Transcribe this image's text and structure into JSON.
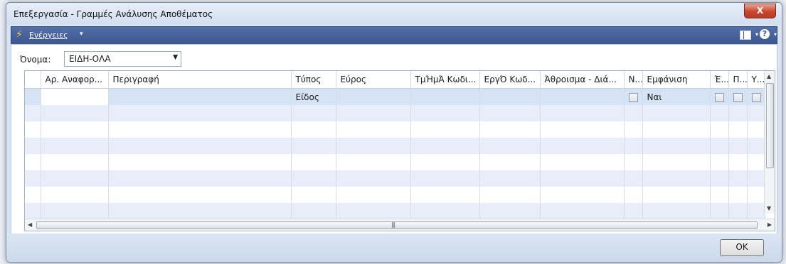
{
  "window": {
    "title": "Επεξεργασία - Γραμμές Ανάλυσης Αποθέματος",
    "close": "X"
  },
  "actionbar": {
    "actions_label": "Ενέργειες",
    "caret": "▾"
  },
  "filter": {
    "label": "Όνομα:",
    "value": "ΕΙΔΗ-ΟΛΑ"
  },
  "table": {
    "columns": [
      "Αρ. Αναφορ...",
      "Περιγραφή",
      "Τύπος",
      "Εύρος",
      "ΤμΉμΆ Κωδι...",
      "ΕργΌ Κωδ...",
      "Άθροισμα - Διά...",
      "Ν...",
      "Εμφάνιση",
      "Έ...",
      "Π...",
      "Υ..."
    ],
    "row1": {
      "type": "Είδος",
      "display": "Ναι"
    }
  },
  "footer": {
    "ok_label": "OK"
  }
}
